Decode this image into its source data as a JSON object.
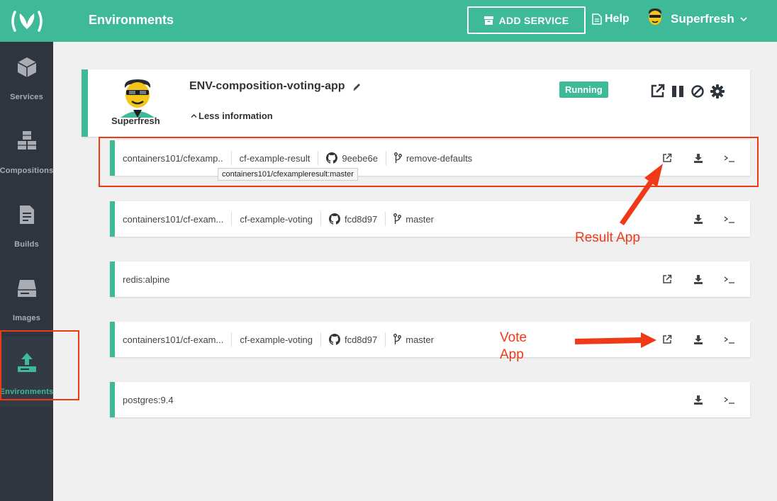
{
  "sidebar": {
    "items": [
      {
        "label": "Services",
        "icon": "cube-icon"
      },
      {
        "label": "Compositions",
        "icon": "cubes-icon"
      },
      {
        "label": "Builds",
        "icon": "document-icon"
      },
      {
        "label": "Images",
        "icon": "drive-icon"
      },
      {
        "label": "Environments",
        "icon": "upload-icon"
      }
    ],
    "active": "Environments"
  },
  "header": {
    "title": "Environments",
    "add_service_label": "ADD SERVICE",
    "help_label": "Help",
    "user_name": "Superfresh"
  },
  "environment": {
    "owner": "Superfresh",
    "name": "ENV-composition-voting-app",
    "status": "Running",
    "less_info_label": "Less information"
  },
  "services": [
    {
      "image": "containers101/cfexamp..",
      "name": "cf-example-result",
      "commit": "9eebe6e",
      "branch": "remove-defaults"
    },
    {
      "image": "containers101/cf-exam...",
      "name": "cf-example-voting",
      "commit": "fcd8d97",
      "branch": "master"
    },
    {
      "image": "redis:alpine"
    },
    {
      "image": "containers101/cf-exam...",
      "name": "cf-example-voting",
      "commit": "fcd8d97",
      "branch": "master"
    },
    {
      "image": "postgres:9.4"
    }
  ],
  "tooltip": "containers101/cfexampleresult:master",
  "annotations": {
    "result_app": "Result App",
    "vote_app_line1": "Vote",
    "vote_app_line2": "App"
  },
  "colors": {
    "brand": "#3fba99",
    "sidebar": "#2f353f",
    "annotation": "#f03a17"
  }
}
